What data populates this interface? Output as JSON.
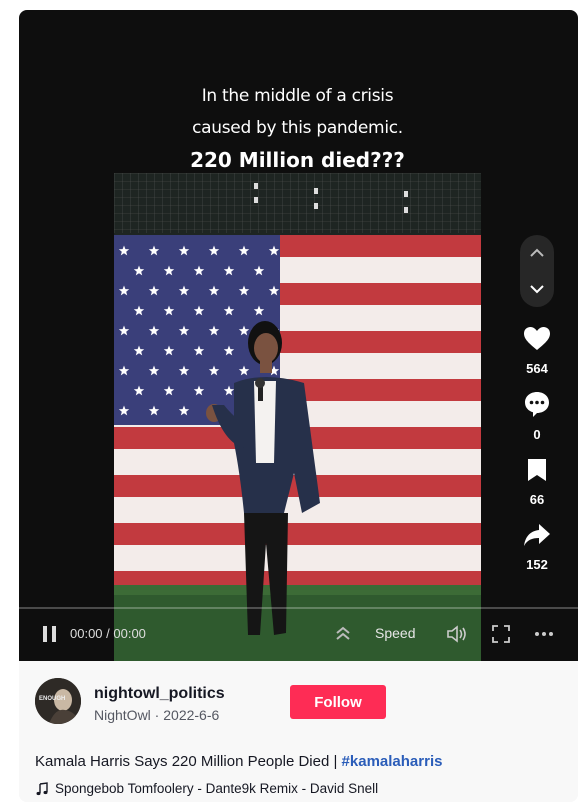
{
  "video": {
    "caption_line1": "In the middle of a crisis",
    "caption_line2": "caused by this pandemic.",
    "caption_line3": "220 Million died???"
  },
  "actions": {
    "likes": "564",
    "comments": "0",
    "saves": "66",
    "shares": "152"
  },
  "player": {
    "time": "00:00 / 00:00",
    "speed_label": "Speed",
    "progress": 0
  },
  "author": {
    "username": "nightowl_politics",
    "display_name": "NightOwl",
    "date": "2022-6-6",
    "separator": " · ",
    "follow_label": "Follow",
    "avatar_text": "ENOUGH"
  },
  "post": {
    "description": "Kamala Harris Says 220 Million People Died | ",
    "hashtag": "#kamalaharris",
    "music": "Spongebob Tomfoolery - Dante9k Remix - David Snell"
  },
  "colors": {
    "follow_bg": "#fe2c55",
    "hashtag": "#2b5db9",
    "player_bg": "#0e0e0e"
  }
}
